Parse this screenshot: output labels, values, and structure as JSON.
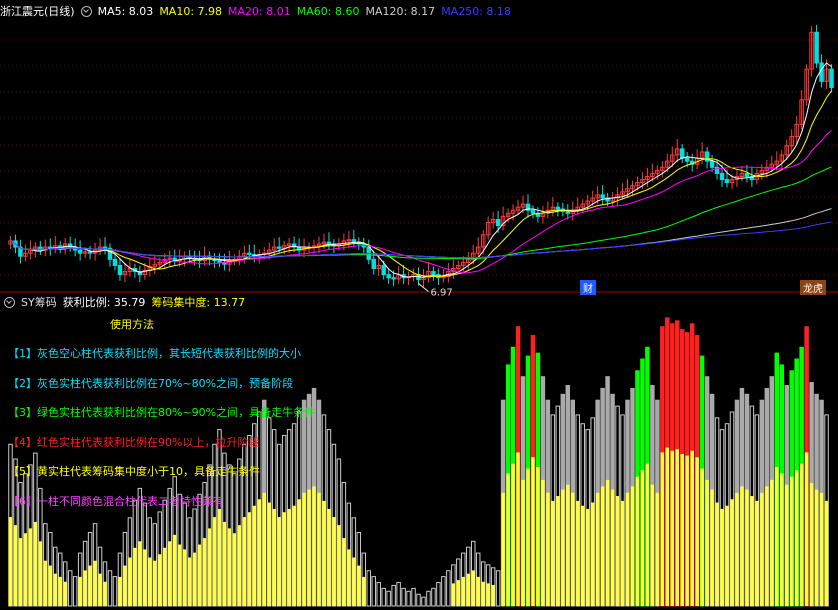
{
  "header": {
    "title": "浙江震元(日线)",
    "ma": [
      {
        "label": "MA5: 8.03",
        "color": "#ffffff"
      },
      {
        "label": "MA10: 7.98",
        "color": "#ffff00"
      },
      {
        "label": "MA20: 8.01",
        "color": "#ff00ff"
      },
      {
        "label": "MA60: 8.60",
        "color": "#00ff00"
      },
      {
        "label": "MA120: 8.17",
        "color": "#cccccc"
      },
      {
        "label": "MA250: 8.18",
        "color": "#3b3bff"
      }
    ]
  },
  "price_panel": {
    "low_label": "6.97",
    "tags": [
      {
        "label": "财",
        "color": "#1e5aff"
      },
      {
        "label": "龙虎",
        "color": "#8b4513"
      }
    ]
  },
  "indicator": {
    "name": "SY筹码",
    "fields": [
      {
        "label": "获利比例: 35.79",
        "color": "#ffffff"
      },
      {
        "label": "筹码集中度: 13.77",
        "color": "#ffff00"
      }
    ],
    "usage_title": "使用方法",
    "legend": [
      {
        "text": "【1】灰色空心柱代表获利比例，其长短代表获利比例的大小",
        "color": "#00e0ff"
      },
      {
        "text": "【2】灰色实柱代表获利比例在70%~80%之间，预备阶段",
        "color": "#00e0ff"
      },
      {
        "text": "【3】绿色实柱代表获利比例在80%~90%之间，具备走牛条件",
        "color": "#00ff00"
      },
      {
        "text": "【4】红色实柱代表获利比例在90%以上，拉升阶段",
        "color": "#ff2020"
      },
      {
        "text": "【5】黄实柱代表筹码集中度小于10，具备走牛条件",
        "color": "#ffff00"
      },
      {
        "text": "【6】一柱不同颜色混合柱代表二者特性兼有",
        "color": "#ff40ff"
      }
    ]
  },
  "chart_data": [
    {
      "type": "candlestick",
      "title": "浙江震元(日线)",
      "x": [
        1,
        2,
        3,
        4,
        5,
        6,
        7,
        8,
        9,
        10,
        11,
        12,
        13,
        14,
        15,
        16,
        17,
        18,
        19,
        20,
        21,
        22,
        23,
        24,
        25,
        26,
        27,
        28,
        29,
        30,
        31,
        32,
        33,
        34,
        35,
        36,
        37,
        38,
        39,
        40,
        41,
        42,
        43,
        44,
        45,
        46,
        47,
        48,
        49,
        50,
        51,
        52,
        53,
        54,
        55,
        56,
        57,
        58,
        59,
        60,
        61,
        62,
        63,
        64,
        65,
        66,
        67,
        68,
        69,
        70,
        71,
        72,
        73,
        74,
        75,
        76,
        77,
        78,
        79,
        80,
        81,
        82,
        83,
        84,
        85,
        86,
        87,
        88,
        89,
        90,
        91,
        92,
        93,
        94,
        95,
        96,
        97,
        98,
        99,
        100,
        101,
        102,
        103,
        104,
        105,
        106,
        107,
        108,
        109,
        110,
        111,
        112,
        113,
        114,
        115,
        116,
        117,
        118,
        119,
        120,
        121,
        122,
        123,
        124,
        125,
        126,
        127,
        128,
        129,
        130,
        131,
        132,
        133,
        134,
        135,
        136,
        137,
        138,
        139,
        140,
        141,
        142,
        143,
        144,
        145,
        146,
        147,
        148,
        149,
        150,
        151,
        152,
        153,
        154,
        155,
        156,
        157,
        158,
        159,
        160,
        161,
        162,
        163,
        164,
        165,
        166
      ],
      "close": [
        7.6,
        7.5,
        7.35,
        7.4,
        7.45,
        7.5,
        7.45,
        7.5,
        7.48,
        7.52,
        7.5,
        7.55,
        7.5,
        7.45,
        7.4,
        7.42,
        7.4,
        7.45,
        7.5,
        7.48,
        7.3,
        7.2,
        7.05,
        7.1,
        7.15,
        7.1,
        7.05,
        7.12,
        7.18,
        7.22,
        7.25,
        7.3,
        7.32,
        7.28,
        7.3,
        7.35,
        7.32,
        7.3,
        7.28,
        7.35,
        7.3,
        7.28,
        7.25,
        7.22,
        7.28,
        7.3,
        7.35,
        7.4,
        7.38,
        7.35,
        7.38,
        7.4,
        7.45,
        7.5,
        7.48,
        7.52,
        7.55,
        7.5,
        7.45,
        7.48,
        7.5,
        7.52,
        7.55,
        7.58,
        7.55,
        7.52,
        7.55,
        7.6,
        7.62,
        7.58,
        7.55,
        7.5,
        7.3,
        7.15,
        7.2,
        7.05,
        7.0,
        6.98,
        7.05,
        7.0,
        7.02,
        7.05,
        6.97,
        7.0,
        7.1,
        7.05,
        7.0,
        7.02,
        7.1,
        7.15,
        7.2,
        7.25,
        7.3,
        7.4,
        7.5,
        7.7,
        7.9,
        7.95,
        7.85,
        8.0,
        8.05,
        8.1,
        8.15,
        8.2,
        8.1,
        8.05,
        8.0,
        8.05,
        8.1,
        8.15,
        8.12,
        8.08,
        8.05,
        8.1,
        8.15,
        8.2,
        8.25,
        8.3,
        8.35,
        8.3,
        8.25,
        8.3,
        8.35,
        8.4,
        8.45,
        8.5,
        8.55,
        8.6,
        8.65,
        8.7,
        8.75,
        8.8,
        8.9,
        9.0,
        9.1,
        8.95,
        8.9,
        8.85,
        8.95,
        9.05,
        8.9,
        8.8,
        8.7,
        8.6,
        8.55,
        8.6,
        8.65,
        8.7,
        8.65,
        8.6,
        8.7,
        8.75,
        8.8,
        8.85,
        8.9,
        9.0,
        9.15,
        9.3,
        9.5,
        9.9,
        10.4,
        11.0,
        10.5,
        10.2,
        10.4,
        10.1
      ],
      "series": [
        {
          "name": "MA5",
          "color": "#ffffff"
        },
        {
          "name": "MA10",
          "color": "#ffff00"
        },
        {
          "name": "MA20",
          "color": "#ff00ff"
        },
        {
          "name": "MA60",
          "color": "#00ff00"
        },
        {
          "name": "MA120",
          "color": "#cccccc"
        },
        {
          "name": "MA250",
          "color": "#3b3bff"
        }
      ],
      "annotations": [
        "6.97"
      ]
    },
    {
      "type": "bar",
      "title": "SY筹码",
      "x": [
        1,
        2,
        3,
        4,
        5,
        6,
        7,
        8,
        9,
        10,
        11,
        12,
        13,
        14,
        15,
        16,
        17,
        18,
        19,
        20,
        21,
        22,
        23,
        24,
        25,
        26,
        27,
        28,
        29,
        30,
        31,
        32,
        33,
        34,
        35,
        36,
        37,
        38,
        39,
        40,
        41,
        42,
        43,
        44,
        45,
        46,
        47,
        48,
        49,
        50,
        51,
        52,
        53,
        54,
        55,
        56,
        57,
        58,
        59,
        60,
        61,
        62,
        63,
        64,
        65,
        66,
        67,
        68,
        69,
        70,
        71,
        72,
        73,
        74,
        75,
        76,
        77,
        78,
        79,
        80,
        81,
        82,
        83,
        84,
        85,
        86,
        87,
        88,
        89,
        90,
        91,
        92,
        93,
        94,
        95,
        96,
        97,
        98,
        99,
        100,
        101,
        102,
        103,
        104,
        105,
        106,
        107,
        108,
        109,
        110,
        111,
        112,
        113,
        114,
        115,
        116,
        117,
        118,
        119,
        120,
        121,
        122,
        123,
        124,
        125,
        126,
        127,
        128,
        129,
        130,
        131,
        132,
        133,
        134,
        135,
        136,
        137,
        138,
        139,
        140,
        141,
        142,
        143,
        144,
        145,
        146,
        147,
        148,
        149,
        150,
        151,
        152,
        153,
        154,
        155,
        156,
        157,
        158,
        159,
        160,
        161,
        162,
        163,
        164,
        165,
        166
      ],
      "profit_ratio": [
        55,
        50,
        42,
        45,
        48,
        52,
        40,
        28,
        25,
        20,
        18,
        15,
        12,
        10,
        18,
        22,
        25,
        28,
        20,
        15,
        12,
        10,
        18,
        25,
        30,
        36,
        40,
        35,
        30,
        28,
        32,
        36,
        40,
        44,
        38,
        35,
        30,
        33,
        38,
        42,
        48,
        55,
        60,
        52,
        48,
        45,
        50,
        55,
        58,
        62,
        66,
        70,
        64,
        60,
        55,
        58,
        60,
        62,
        66,
        70,
        72,
        74,
        70,
        65,
        60,
        55,
        50,
        42,
        35,
        30,
        25,
        18,
        12,
        10,
        8,
        6,
        5,
        7,
        8,
        6,
        5,
        6,
        4,
        3,
        5,
        6,
        8,
        10,
        12,
        14,
        16,
        18,
        20,
        22,
        18,
        15,
        14,
        13,
        12,
        70,
        82,
        88,
        95,
        78,
        85,
        92,
        86,
        78,
        70,
        65,
        68,
        72,
        75,
        70,
        65,
        62,
        60,
        64,
        70,
        74,
        78,
        72,
        68,
        65,
        70,
        74,
        80,
        84,
        88,
        75,
        70,
        95,
        98,
        96,
        97,
        94,
        93,
        96,
        92,
        85,
        78,
        72,
        64,
        60,
        62,
        66,
        70,
        74,
        72,
        68,
        65,
        70,
        74,
        78,
        86,
        82,
        75,
        80,
        84,
        88,
        95,
        76,
        72,
        70,
        65
      ],
      "concentration_lt10": [
        false,
        false,
        false,
        false,
        false,
        false,
        false,
        false,
        false,
        false,
        false,
        false,
        false,
        false,
        false,
        false,
        false,
        false,
        false,
        false,
        false,
        false,
        false,
        false,
        false,
        false,
        false,
        false,
        false,
        false,
        false,
        false,
        false,
        false,
        false,
        false,
        false,
        false,
        false,
        false,
        false,
        false,
        false,
        false,
        false,
        false,
        false,
        false,
        false,
        false,
        false,
        false,
        false,
        false,
        false,
        false,
        false,
        false,
        false,
        false,
        false,
        false,
        false,
        false,
        false,
        false,
        false,
        false,
        false,
        false,
        false,
        false,
        false,
        false,
        false,
        false,
        false,
        false,
        false,
        false,
        false,
        false,
        false,
        false,
        false,
        false,
        false,
        false,
        false,
        false,
        false,
        false,
        false,
        false,
        false,
        false,
        false,
        false,
        false,
        false,
        false,
        false,
        false,
        false,
        false,
        false,
        false,
        false,
        false,
        false,
        false,
        false,
        false,
        false,
        false,
        false,
        false,
        false,
        false,
        false,
        false,
        false,
        false,
        false,
        false,
        false,
        false,
        false,
        false,
        false,
        false,
        false,
        false,
        false,
        false,
        false,
        false,
        false,
        false,
        false,
        false,
        false,
        false,
        false,
        false,
        false,
        false,
        false,
        false,
        false,
        false,
        false,
        false,
        false,
        false,
        false,
        false,
        false,
        false,
        false,
        false,
        false,
        false,
        false,
        false,
        false
      ],
      "ylim": [
        0,
        100
      ]
    }
  ]
}
